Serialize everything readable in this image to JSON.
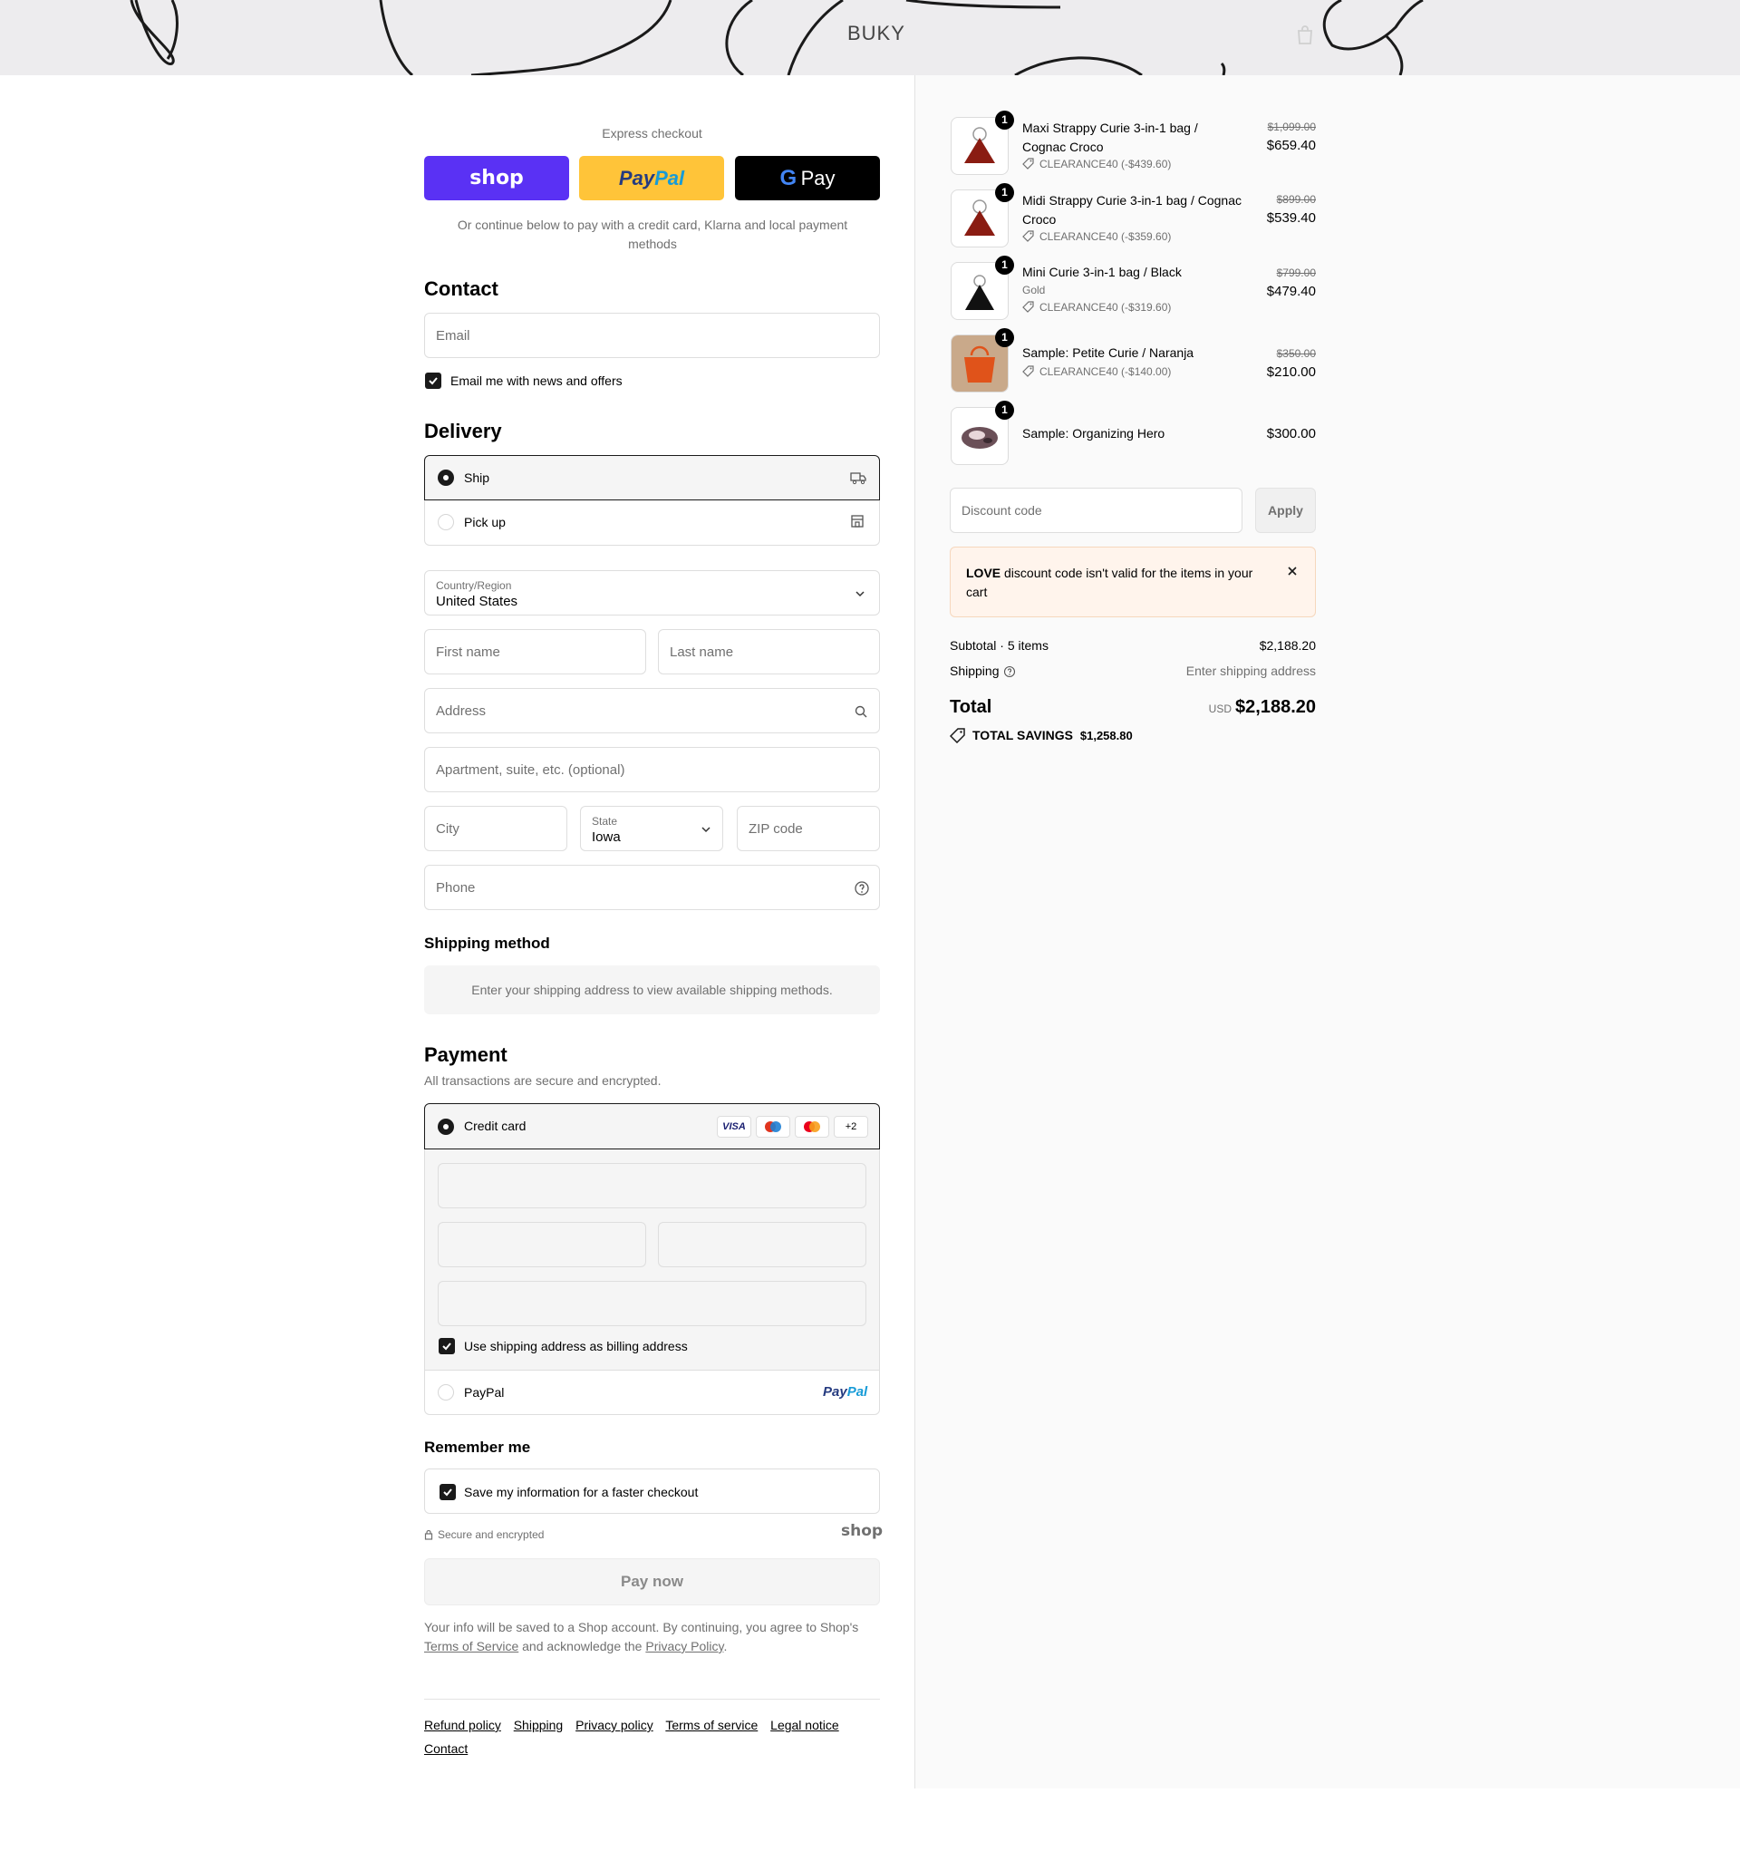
{
  "header": {
    "logo": "BUKY"
  },
  "express": {
    "title": "Express checkout",
    "shop_label": "shop",
    "paypal_label_a": "Pay",
    "paypal_label_b": "Pal",
    "gpay_label": "Pay",
    "note": "Or continue below to pay with a credit card, Klarna and local payment methods"
  },
  "contact": {
    "title": "Contact",
    "email_placeholder": "Email",
    "news_label": "Email me with news and offers",
    "news_checked": true
  },
  "delivery": {
    "title": "Delivery",
    "options": [
      {
        "label": "Ship",
        "selected": true
      },
      {
        "label": "Pick up",
        "selected": false
      }
    ],
    "country_label": "Country/Region",
    "country_value": "United States",
    "first_name": "First name",
    "last_name": "Last name",
    "address": "Address",
    "apartment": "Apartment, suite, etc. (optional)",
    "city": "City",
    "state_label": "State",
    "state_value": "Iowa",
    "zip": "ZIP code",
    "phone": "Phone"
  },
  "shipping_method": {
    "title": "Shipping method",
    "message": "Enter your shipping address to view available shipping methods."
  },
  "payment": {
    "title": "Payment",
    "subtitle": "All transactions are secure and encrypted.",
    "credit_card_label": "Credit card",
    "card_brands": [
      "VISA",
      "maestro",
      "mastercard"
    ],
    "more_brands": "+2",
    "billing_label": "Use shipping address as billing address",
    "paypal_label": "PayPal",
    "paypal_logo_a": "Pay",
    "paypal_logo_b": "Pal"
  },
  "remember": {
    "title": "Remember me",
    "save_label": "Save my information for a faster checkout",
    "secure_label": "Secure and encrypted",
    "shop_logo": "shop"
  },
  "pay_button": "Pay now",
  "legal": {
    "text_a": "Your info will be saved to a Shop account. By continuing, you agree to Shop's",
    "terms": "Terms of Service",
    "text_b": "and acknowledge the",
    "privacy": "Privacy Policy",
    "text_c": "."
  },
  "footer_links": [
    "Refund policy",
    "Shipping",
    "Privacy policy",
    "Terms of service",
    "Legal notice",
    "Contact"
  ],
  "cart": {
    "items": [
      {
        "qty": "1",
        "name": "Maxi Strappy Curie 3-in-1 bag / Cognac Croco",
        "variant": "",
        "discount": "CLEARANCE40 (-$439.60)",
        "original": "$1,099.00",
        "price": "$659.40",
        "color": "#8a1c12"
      },
      {
        "qty": "1",
        "name": "Midi Strappy Curie 3-in-1 bag / Cognac Croco",
        "variant": "",
        "discount": "CLEARANCE40 (-$359.60)",
        "original": "$899.00",
        "price": "$539.40",
        "color": "#8a1c12"
      },
      {
        "qty": "1",
        "name": "Mini Curie 3-in-1 bag / Black",
        "variant": "Gold",
        "discount": "CLEARANCE40 (-$319.60)",
        "original": "$799.00",
        "price": "$479.40",
        "color": "#111111"
      },
      {
        "qty": "1",
        "name": "Sample: Petite Curie / Naranja",
        "variant": "",
        "discount": "CLEARANCE40 (-$140.00)",
        "original": "$350.00",
        "price": "$210.00",
        "color": "#e0531a"
      },
      {
        "qty": "1",
        "name": "Sample: Organizing Hero",
        "variant": "",
        "discount": "",
        "original": "",
        "price": "$300.00",
        "color": "#6b5058"
      }
    ],
    "discount_placeholder": "Discount code",
    "apply_label": "Apply",
    "error_code": "LOVE",
    "error_text": "discount code isn't valid for the items in your cart",
    "subtotal_label": "Subtotal · 5 items",
    "subtotal_value": "$2,188.20",
    "shipping_label": "Shipping",
    "shipping_value": "Enter shipping address",
    "total_label": "Total",
    "currency": "USD",
    "total_value": "$2,188.20",
    "savings_label": "TOTAL SAVINGS",
    "savings_value": "$1,258.80"
  }
}
